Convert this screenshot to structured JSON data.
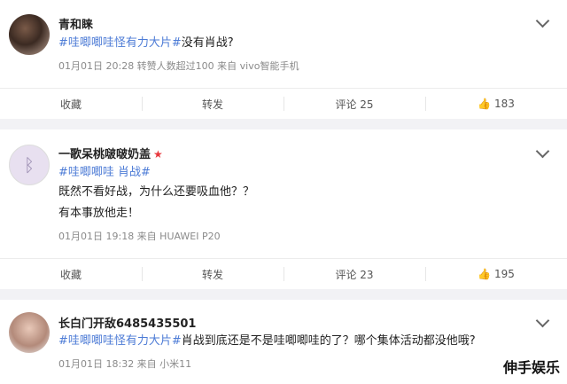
{
  "posts": [
    {
      "username": "青和睐",
      "content": [
        {
          "topic": "#哇唧唧哇怪有力大片#",
          "text": "没有肖战?"
        }
      ],
      "meta": "01月01日 20:28 转赞人数超过100 来自 vivo智能手机",
      "actions": {
        "favorite": "收藏",
        "repost": "转发",
        "comment": "评论 25",
        "like": "183"
      }
    },
    {
      "username": "一歌呆桃啵啵奶盖",
      "topic_line": "#哇唧唧哇 肖战#",
      "lines": [
        "既然不看好战，为什么还要吸血他？？",
        "有本事放他走！"
      ],
      "meta": "01月01日 19:18 来自 HUAWEI P20",
      "actions": {
        "favorite": "收藏",
        "repost": "转发",
        "comment": "评论 23",
        "like": "195"
      }
    },
    {
      "username": "长白门开敌6485435501",
      "content": [
        {
          "topic": "#哇唧唧哇怪有力大片#",
          "text": "肖战到底还是不是哇唧唧哇的了？哪个集体活动都没他哦?"
        }
      ],
      "meta": "01月01日 18:32 来自 小米11"
    }
  ],
  "watermark": "伸手娱乐",
  "colors": {
    "topic": "#eb7350",
    "topic_blue": "#4c7bd6",
    "vip_star": "#e8383d"
  },
  "icons": {
    "more": "chevron-down-icon",
    "like": "thumbs-up-icon",
    "vip": "star-icon"
  }
}
